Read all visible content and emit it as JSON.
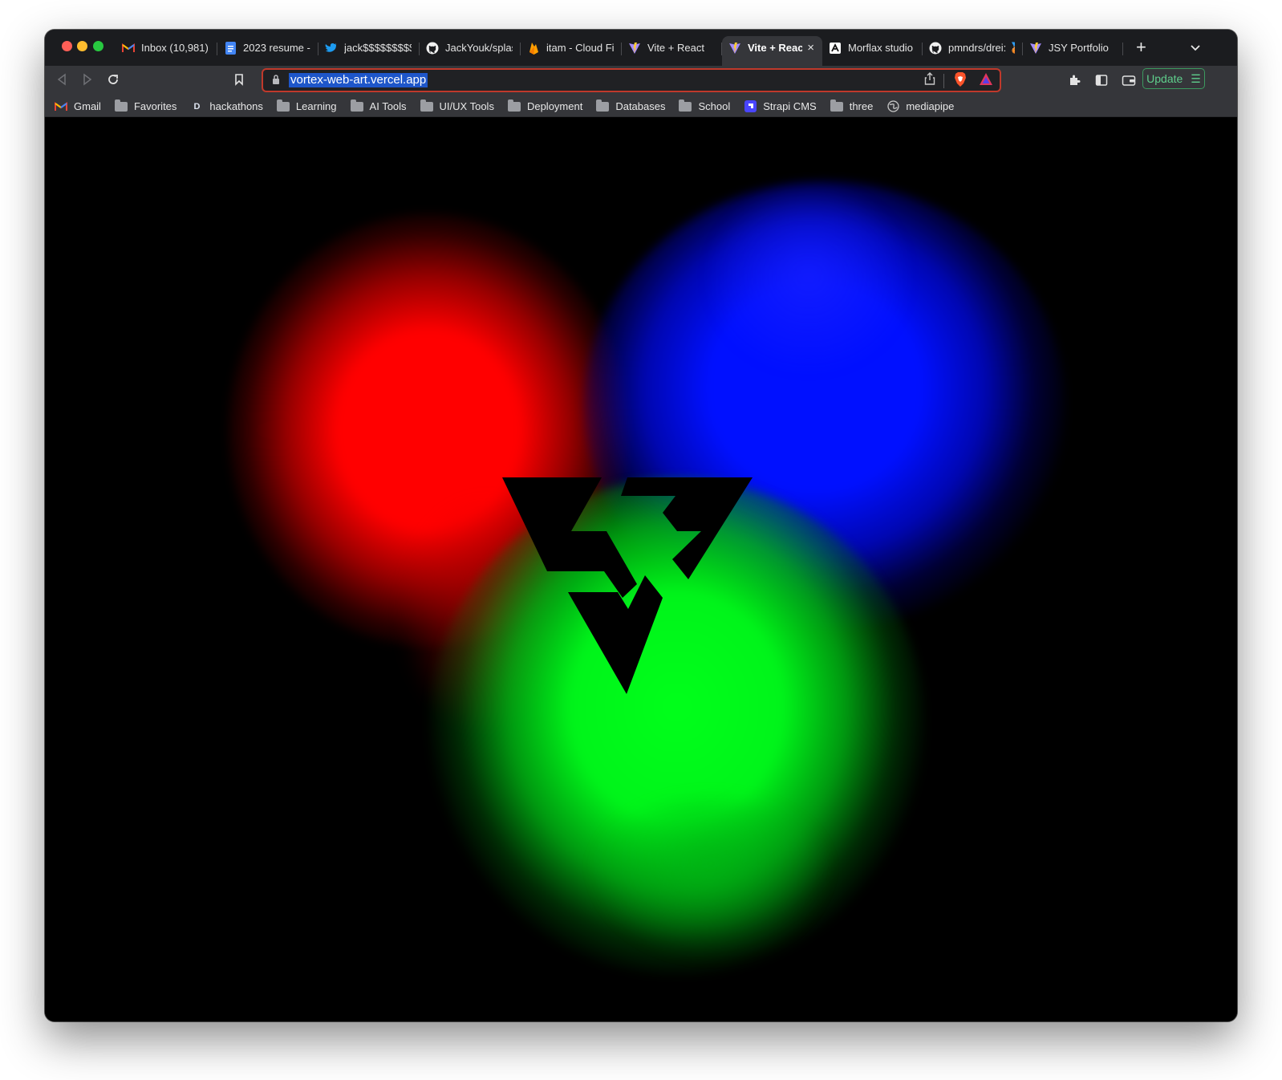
{
  "browser": {
    "tabs": [
      {
        "label": "Inbox (10,981) -",
        "icon": "gmail-icon",
        "active": false,
        "width": 127
      },
      {
        "label": "2023 resume - (",
        "icon": "google-docs-icon",
        "active": false,
        "width": 126
      },
      {
        "label": "jack$$$$$$$$$",
        "icon": "twitter-icon",
        "active": false,
        "width": 126
      },
      {
        "label": "JackYouk/splash",
        "icon": "github-icon",
        "active": false,
        "width": 126
      },
      {
        "label": "itam - Cloud Fire",
        "icon": "firebase-icon",
        "active": false,
        "width": 126
      },
      {
        "label": "Vite + React",
        "icon": "vite-icon",
        "active": false,
        "width": 125
      },
      {
        "label": "Vite + React",
        "icon": "vite-icon",
        "active": true,
        "width": 125
      },
      {
        "label": "Morflax studio -",
        "icon": "morflax-icon",
        "active": false,
        "width": 125
      },
      {
        "label": "pmndrs/drei: 🥉",
        "icon": "github-icon",
        "active": false,
        "width": 125
      },
      {
        "label": "JSY Portfolio",
        "icon": "vite-icon",
        "active": false,
        "width": 125
      }
    ],
    "new_tab": "+",
    "tab_menu": "⌄",
    "close_glyph": "×",
    "url": "vortex-web-art.vercel.app",
    "update_label": "Update",
    "update_menu": "☰",
    "bookmarks": [
      {
        "label": "Gmail",
        "icon": "gmail-icon"
      },
      {
        "label": "Favorites",
        "icon": "folder-icon"
      },
      {
        "label": "hackathons",
        "icon": "devpost-icon"
      },
      {
        "label": "Learning",
        "icon": "folder-icon"
      },
      {
        "label": "AI Tools",
        "icon": "folder-icon"
      },
      {
        "label": "UI/UX Tools",
        "icon": "folder-icon"
      },
      {
        "label": "Deployment",
        "icon": "folder-icon"
      },
      {
        "label": "Databases",
        "icon": "folder-icon"
      },
      {
        "label": "School",
        "icon": "folder-icon"
      },
      {
        "label": "Strapi CMS",
        "icon": "strapi-icon"
      },
      {
        "label": "three",
        "icon": "folder-icon"
      },
      {
        "label": "mediapipe",
        "icon": "globe-icon"
      }
    ]
  },
  "page": {
    "background": "#000000",
    "smoke_colors": {
      "red": "#ff0000",
      "blue": "#0010ff",
      "green": "#00ff1a"
    },
    "logo": "jsy-triangle-logo"
  }
}
